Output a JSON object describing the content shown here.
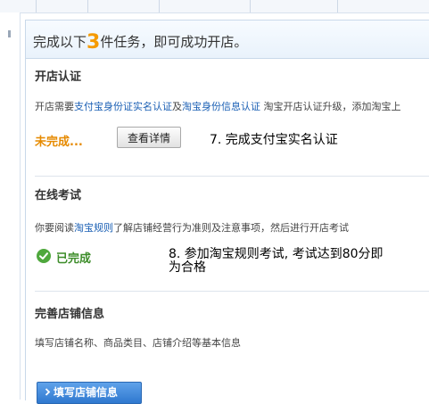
{
  "header": {
    "title_prefix": "完成以下",
    "task_count": "3",
    "title_suffix": "件任务，即可成功开店。"
  },
  "sections": {
    "store_certification": {
      "title": "开店认证",
      "desc_prefix": "开店需要",
      "link_alipay": "支付宝身份证实名认证",
      "desc_and": "及",
      "link_taobao": "淘宝身份信息认证",
      "desc_suffix": " 淘宝开店认证升级，添加淘宝上",
      "status": "未完成...",
      "details_button": "查看详情",
      "annotation": "7. 完成支付宝实名认证"
    },
    "online_exam": {
      "title": "在线考试",
      "desc_prefix": "你要阅读",
      "link_rules": "淘宝规则",
      "desc_suffix": "了解店铺经营行为准则及注意事项，然后进行开店考试",
      "status": "已完成",
      "annotation_line1": "8. 参加淘宝规则考试, 考试达到80分即",
      "annotation_line2": "为合格"
    },
    "store_info": {
      "title": "完善店铺信息",
      "desc": "填写店铺名称、商品类目、店铺介绍等基本信息",
      "fill_button": "填写店铺信息"
    }
  },
  "colors": {
    "accent_orange": "#f59a00",
    "link_blue": "#1a5fb4",
    "success_green": "#4fa83d",
    "button_blue": "#2f78cf"
  }
}
